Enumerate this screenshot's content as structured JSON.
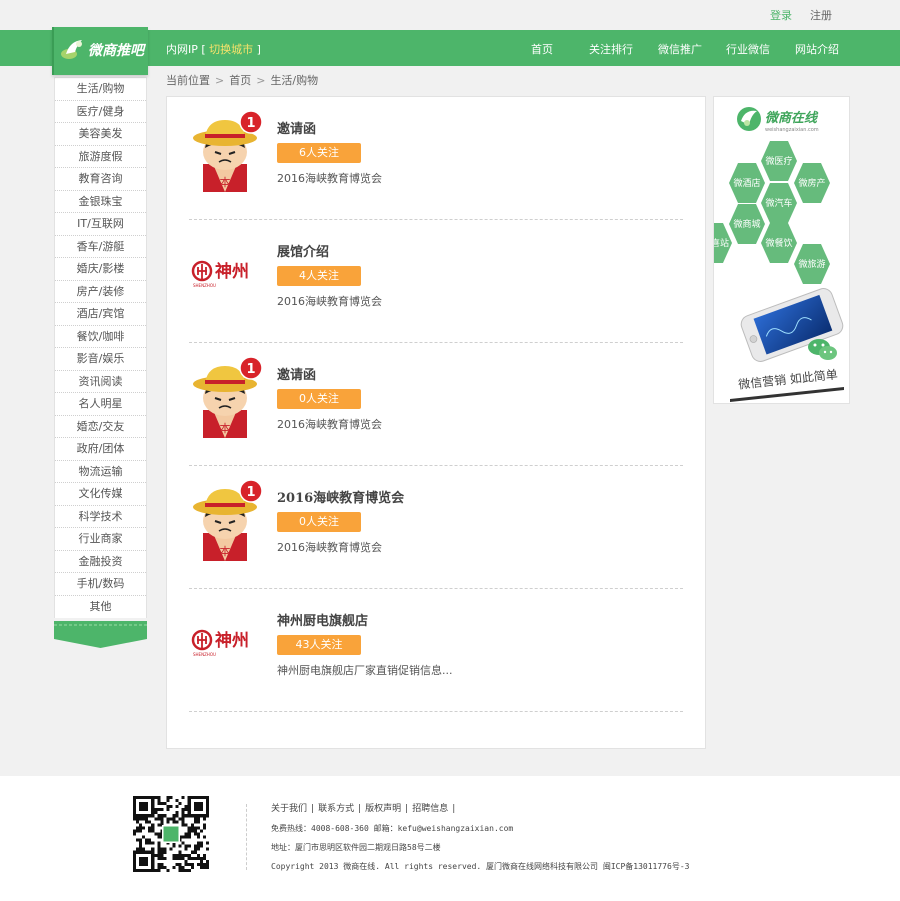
{
  "topbar": {
    "login": "登录",
    "register": "注册"
  },
  "logo": {
    "text": "微商推吧"
  },
  "nav": {
    "ip_prefix": "内网IP [",
    "switch_city": "切换城市",
    "ip_suffix": "]",
    "menu": [
      "首页",
      "关注排行",
      "微信推广",
      "行业微信",
      "网站介绍"
    ]
  },
  "sidebar": {
    "categories": [
      "生活/购物",
      "医疗/健身",
      "美容美发",
      "旅游度假",
      "教育咨询",
      "金银珠宝",
      "IT/互联网",
      "香车/游艇",
      "婚庆/影楼",
      "房产/装修",
      "酒店/宾馆",
      "餐饮/咖啡",
      "影音/娱乐",
      "资讯阅读",
      "名人明星",
      "婚恋/交友",
      "政府/团体",
      "物流运输",
      "文化传媒",
      "科学技术",
      "行业商家",
      "金融投资",
      "手机/数码",
      "其他"
    ]
  },
  "breadcrumb": {
    "label": "当前位置",
    "home": "首页",
    "current": "生活/购物"
  },
  "items": [
    {
      "thumb": "onepiece",
      "title": "邀请函",
      "follow": "6人关注",
      "desc": "2016海峡教育博览会"
    },
    {
      "thumb": "shenzhou",
      "title": "展馆介绍",
      "follow": "4人关注",
      "desc": "2016海峡教育博览会"
    },
    {
      "thumb": "onepiece",
      "title": "邀请函",
      "follow": "0人关注",
      "desc": "2016海峡教育博览会"
    },
    {
      "thumb": "onepiece",
      "title": "2016海峡教育博览会",
      "follow": "0人关注",
      "desc": "2016海峡教育博览会"
    },
    {
      "thumb": "shenzhou",
      "title": "神州厨电旗舰店",
      "follow": "43人关注",
      "desc": "神州厨电旗舰店厂家直销促销信息..."
    }
  ],
  "thumb_text": {
    "badge": "1",
    "chest": "本",
    "shenzhou_cn": "神州",
    "shenzhou_en": "SHENZHOU"
  },
  "ad": {
    "brand": "微商在线",
    "domain": "weishangzaixian.com",
    "hexes": [
      "微医疗",
      "微酒店",
      "微房产",
      "微汽车",
      "微商城",
      "微餐饮",
      "微旅游",
      "喜站"
    ],
    "slogan": "微信营销 如此简单"
  },
  "footer": {
    "links": [
      "关于我们",
      "联系方式",
      "版权声明",
      "招聘信息"
    ],
    "hotline": "免费热线：4008-608-360 邮箱：kefu@weishangzaixian.com",
    "address": "地址：厦门市思明区软件园二期观日路58号二楼",
    "copyright": "Copyright 2013 微商在线. All rights reserved. 厦门微商在线网络科技有限公司 闽ICP备13011776号-3"
  },
  "colors": {
    "brand_green": "#4db56a",
    "follow_orange": "#f9a33a",
    "link_yellow": "#f7e26b"
  }
}
